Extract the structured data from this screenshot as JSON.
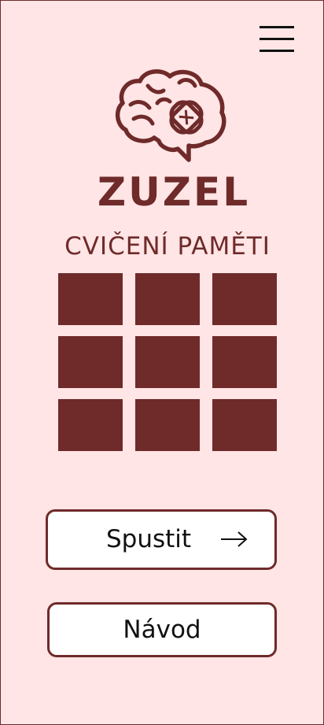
{
  "header": {
    "menu_icon": "hamburger-menu-icon"
  },
  "brand": {
    "logo_icon": "brain-bandage-icon",
    "name": "ZUZEL",
    "subtitle": "CVIČENÍ PAMĚTI"
  },
  "memory_grid": {
    "rows": 3,
    "columns": 3,
    "tile_color": "#6f2a2a"
  },
  "actions": {
    "start_label": "Spustit",
    "start_icon": "arrow-right-icon",
    "help_label": "Návod"
  },
  "colors": {
    "background": "#ffe5e5",
    "accent": "#6f2a2a",
    "button_background": "#ffffff",
    "text": "#111111"
  }
}
